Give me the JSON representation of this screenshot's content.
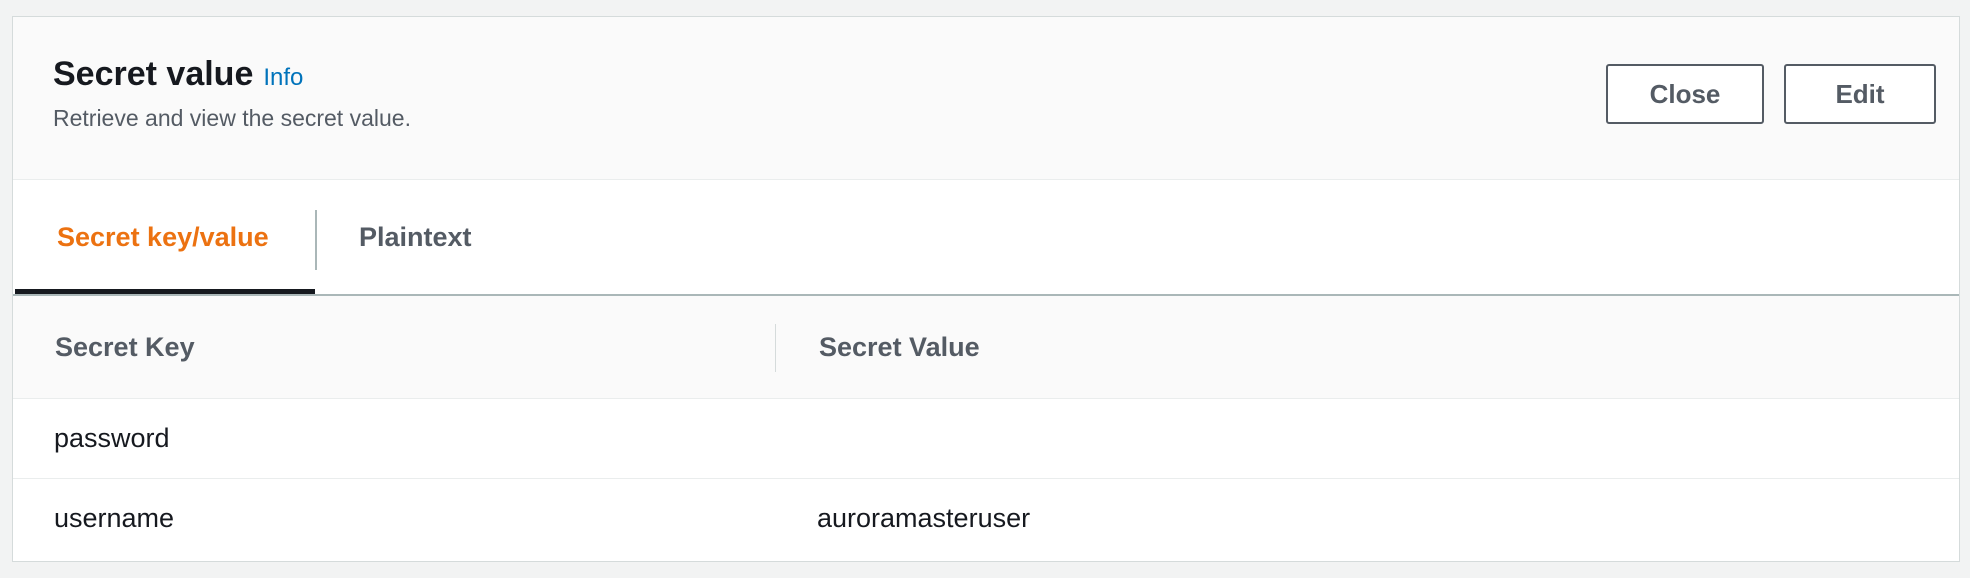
{
  "header": {
    "title": "Secret value",
    "info_link": "Info",
    "subtitle": "Retrieve and view the secret value.",
    "close_label": "Close",
    "edit_label": "Edit"
  },
  "tabs": [
    {
      "label": "Secret key/value",
      "active": true
    },
    {
      "label": "Plaintext",
      "active": false
    }
  ],
  "table": {
    "columns": [
      "Secret Key",
      "Secret Value"
    ],
    "rows": [
      {
        "key": "password",
        "value": ""
      },
      {
        "key": "username",
        "value": "auroramasteruser"
      }
    ]
  },
  "colors": {
    "active_tab": "#ec7211",
    "link": "#0073bb",
    "button_border": "#545b64"
  }
}
